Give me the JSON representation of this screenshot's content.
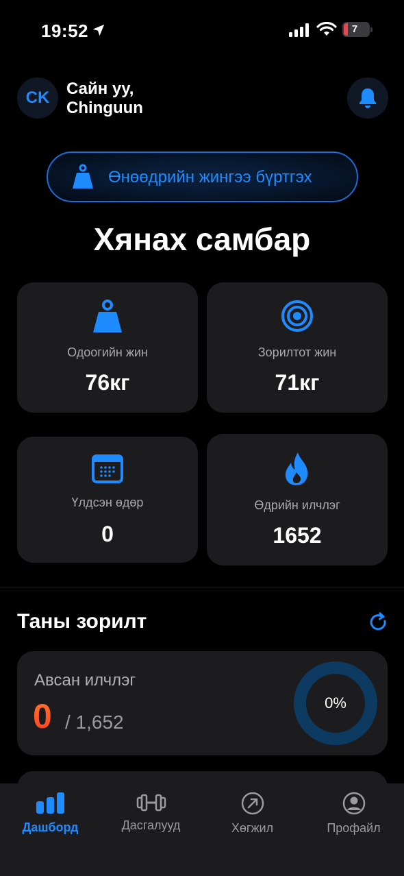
{
  "status_bar": {
    "time": "19:52",
    "battery": "7"
  },
  "header": {
    "avatar_initials": "CK",
    "greeting_line1": "Сайн уу,",
    "greeting_line2": "Chinguun"
  },
  "record_button": {
    "label": "Өнөөдрийн жингээ бүртгэх"
  },
  "page_title": "Хянах самбар",
  "stats": {
    "current_weight": {
      "label": "Одоогийн жин",
      "value": "76кг"
    },
    "target_weight": {
      "label": "Зорилтот жин",
      "value": "71кг"
    },
    "days_left": {
      "label": "Үлдсэн өдөр",
      "value": "0"
    },
    "daily_calories": {
      "label": "Өдрийн илчлэг",
      "value": "1652"
    }
  },
  "goals": {
    "title": "Таны зорилт",
    "calories_taken": {
      "label": "Авсан илчлэг",
      "value": "0",
      "total": "/ 1,652",
      "percent_label": "0%",
      "progress": 0
    }
  },
  "tabs": [
    {
      "label": "Дашборд",
      "active": true
    },
    {
      "label": "Дасгалууд",
      "active": false
    },
    {
      "label": "Хөгжил",
      "active": false
    },
    {
      "label": "Профайл",
      "active": false
    }
  ],
  "colors": {
    "accent": "#1e8bff",
    "card": "#1c1c1e",
    "background": "#000000",
    "calorie_gradient_top": "#ff7a33",
    "ring_track": "#0d3a60"
  }
}
